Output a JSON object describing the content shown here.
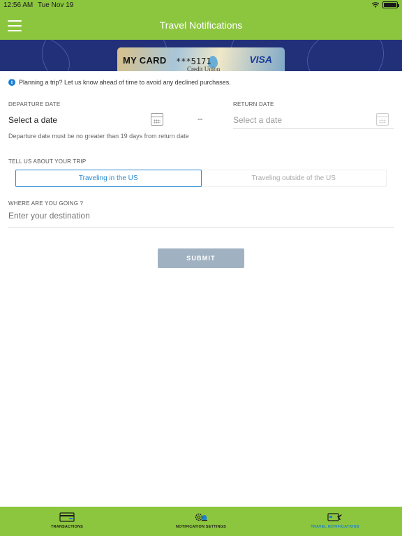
{
  "status_bar": {
    "time": "12:56 AM",
    "date": "Tue Nov 19"
  },
  "header": {
    "title": "Travel Notifications"
  },
  "card": {
    "name": "MY CARD",
    "number": "***5171",
    "issuer": "Credit Union",
    "network": "VISA"
  },
  "info": {
    "text": "Planning a trip? Let us know ahead of time to avoid any declined purchases."
  },
  "departure": {
    "label": "DEPARTURE DATE",
    "value": "Select a date",
    "hint": "Departure date must be no greater than 19 days from return date"
  },
  "separator": "--",
  "return_date": {
    "label": "RETURN DATE",
    "placeholder": "Select a date"
  },
  "trip": {
    "label": "TELL US ABOUT YOUR TRIP",
    "options": [
      {
        "label": "Traveling in the US",
        "selected": true
      },
      {
        "label": "Traveling outside of the US",
        "selected": false
      }
    ]
  },
  "destination": {
    "label": "WHERE ARE YOU GOING ?",
    "placeholder": "Enter your destination"
  },
  "submit_label": "SUBMIT",
  "tabs": [
    {
      "label": "TRANSACTIONS",
      "icon": "credit-card-icon",
      "selected": false
    },
    {
      "label": "NOTIFICATION SETTINGS",
      "icon": "gear-bell-icon",
      "selected": false
    },
    {
      "label": "TRAVEL NOTIFICATIONS",
      "icon": "card-plane-icon",
      "selected": true
    }
  ],
  "colors": {
    "brand_green": "#8cc63f",
    "banner_blue": "#22307a",
    "accent_blue": "#2a8bd0",
    "submit_gray": "#a0b2c2"
  }
}
